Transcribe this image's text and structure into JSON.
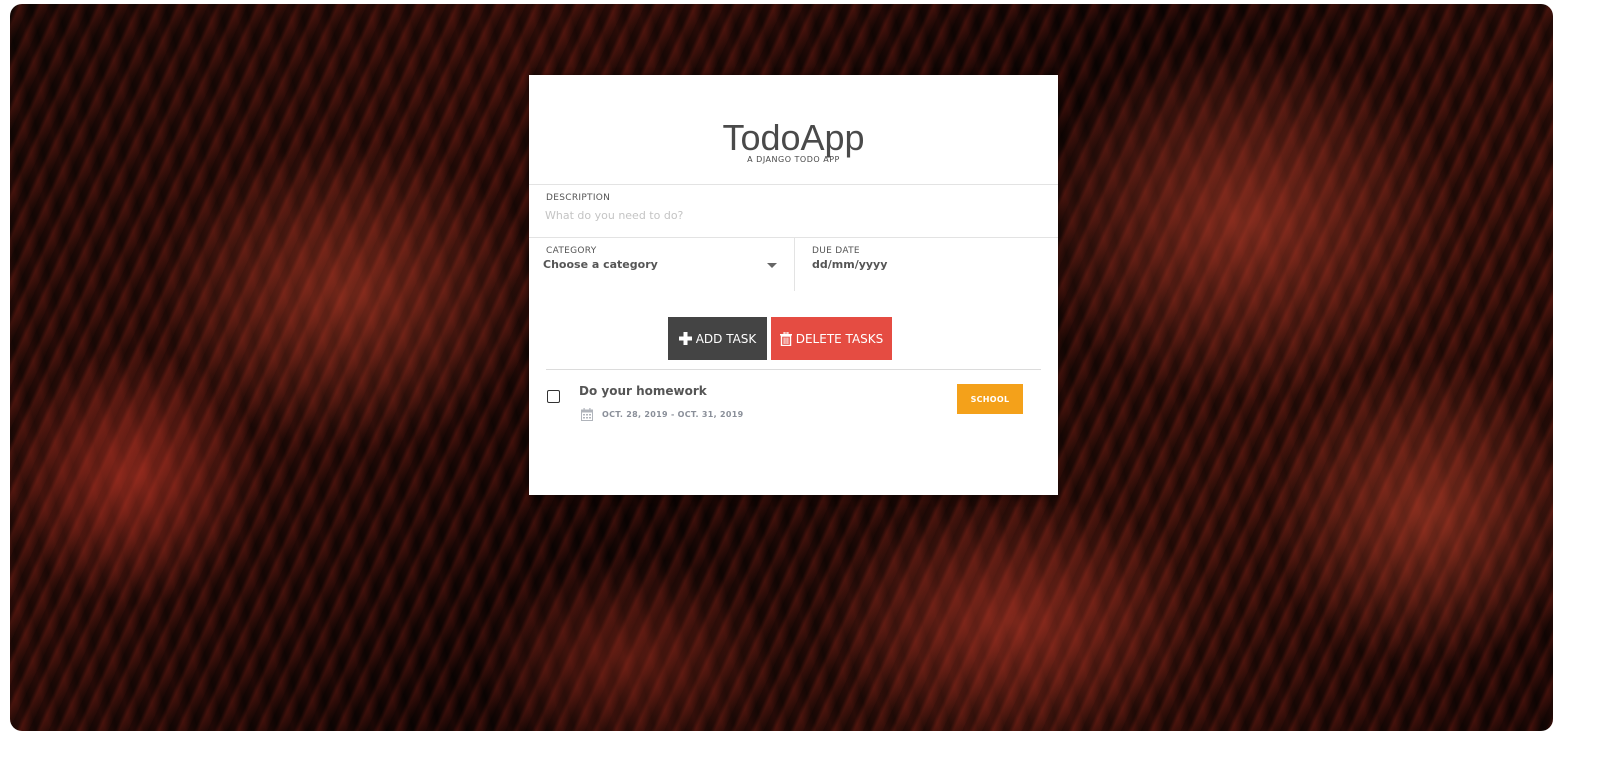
{
  "app": {
    "title": "TodoApp",
    "subtitle": "A DJANGO TODO APP"
  },
  "form": {
    "description_label": "DESCRIPTION",
    "description_placeholder": "What do you need to do?",
    "description_value": "",
    "category_label": "CATEGORY",
    "category_selected": "Choose a category",
    "due_date_label": "DUE DATE",
    "due_date_placeholder": "dd/mm/yyyy"
  },
  "buttons": {
    "add_label": "ADD TASK",
    "delete_label": "DELETE TASKS",
    "add_icon": "plus-icon",
    "delete_icon": "trash-icon"
  },
  "tasks": [
    {
      "title": "Do your homework",
      "dates": "OCT. 28, 2019 - OCT. 31, 2019",
      "category": "SCHOOL",
      "checked": false
    }
  ],
  "colors": {
    "add_button": "#444444",
    "delete_button": "#e54c42",
    "category_tag": "#f4a11a"
  }
}
